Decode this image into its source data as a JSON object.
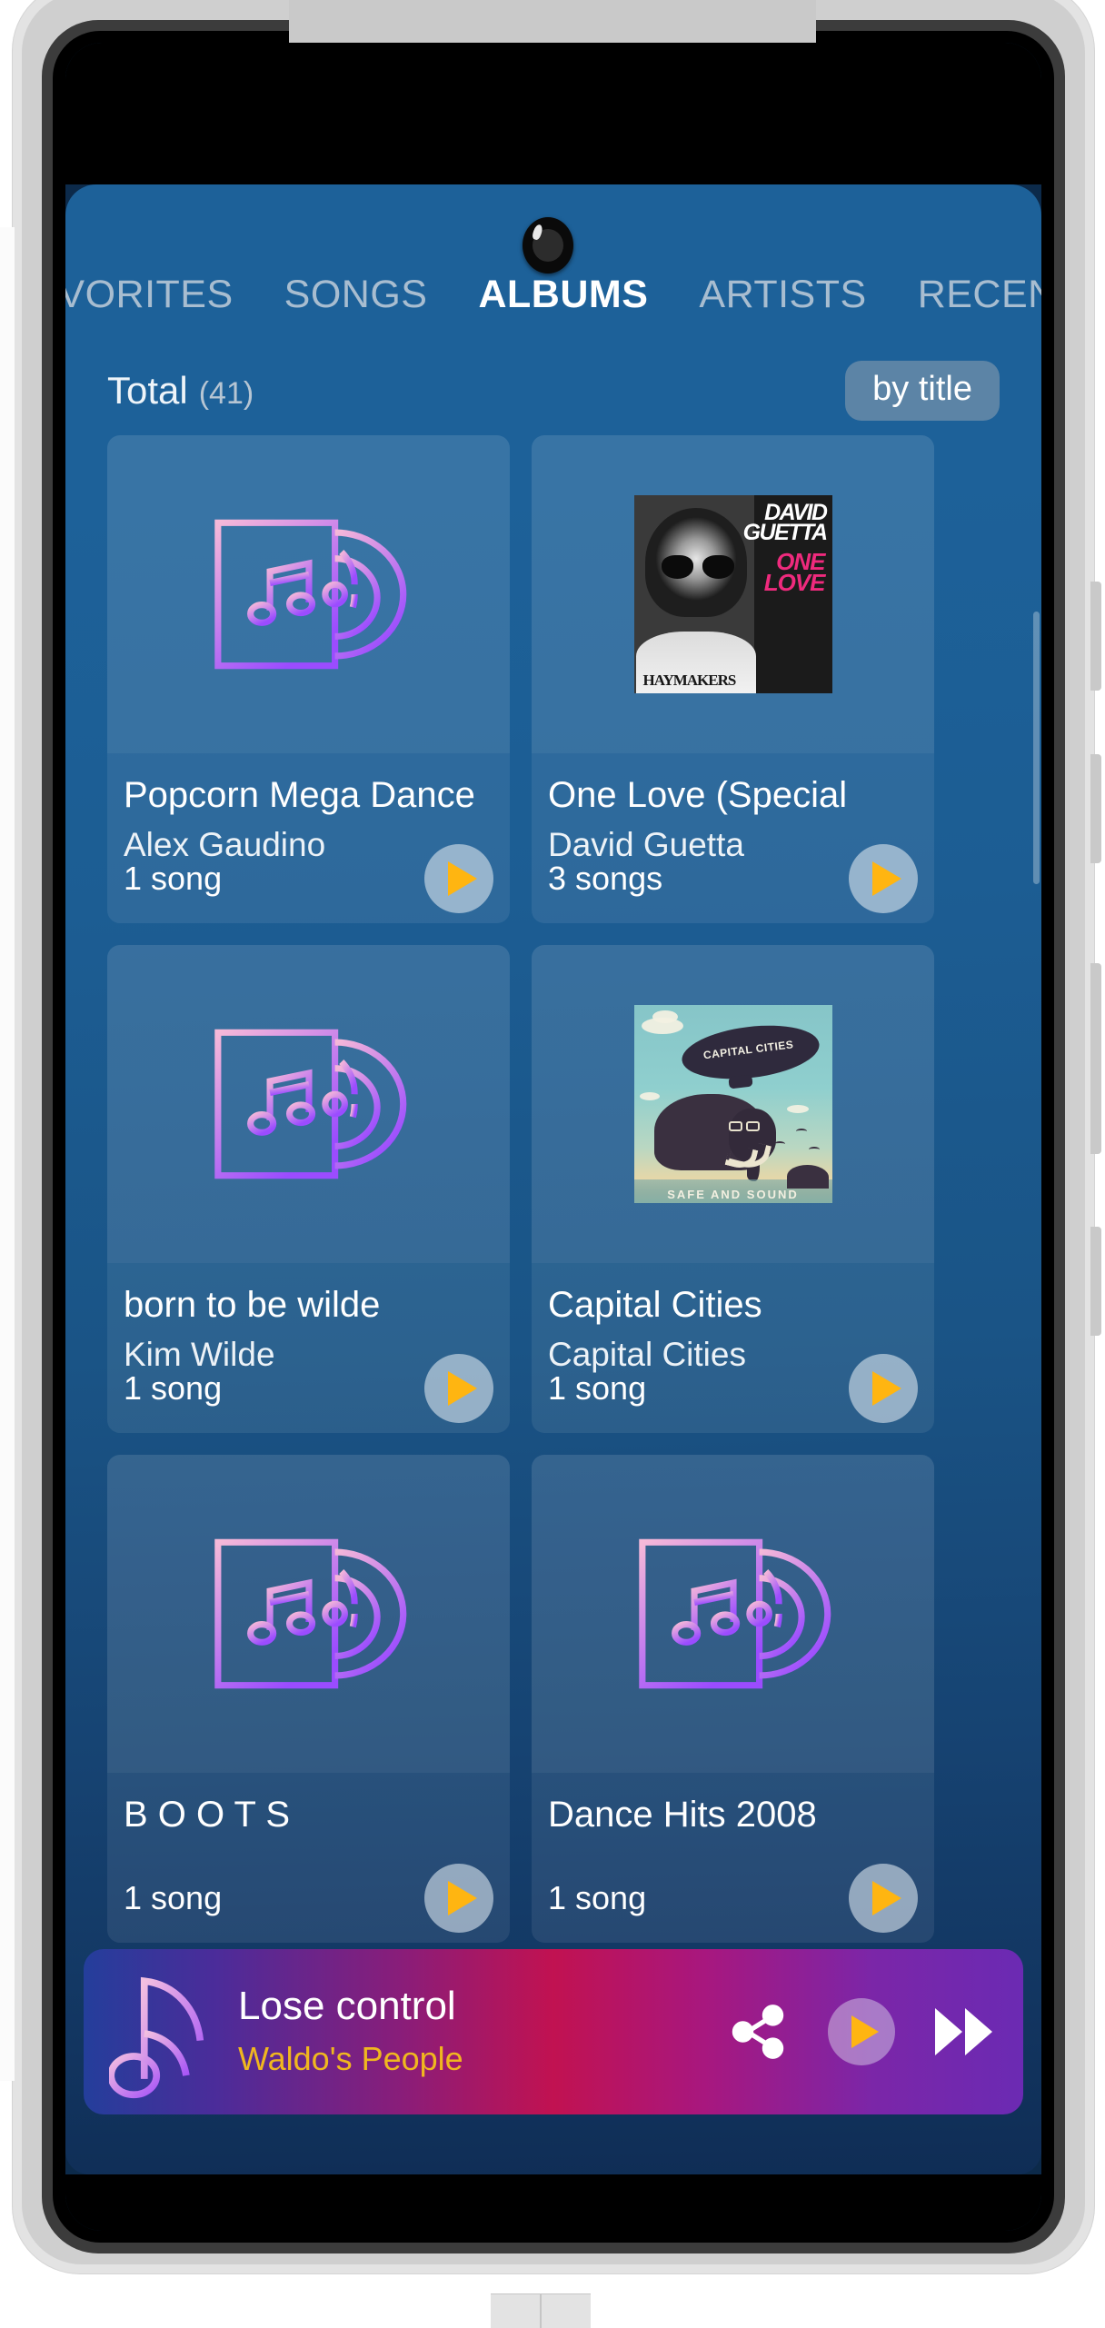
{
  "device": {
    "camera_icon": "front-camera-punch-hole"
  },
  "tabs": [
    {
      "label": "FAVORITES",
      "active": false,
      "truncated_left": true
    },
    {
      "label": "SONGS",
      "active": false
    },
    {
      "label": "ALBUMS",
      "active": true
    },
    {
      "label": "ARTISTS",
      "active": false
    },
    {
      "label": "RECENT",
      "active": false,
      "truncated_right": true
    }
  ],
  "header": {
    "total_label": "Total",
    "total_count": "(41)",
    "sort_button": "by title"
  },
  "albums": [
    {
      "song_count": "1 song",
      "title": "Popcorn Mega Dance",
      "artist": "Alex Gaudino",
      "art": "placeholder",
      "play_icon": "play-icon"
    },
    {
      "song_count": "3 songs",
      "title": "One Love (Special",
      "artist": "David Guetta",
      "art": "guetta",
      "play_icon": "play-icon"
    },
    {
      "song_count": "1 song",
      "title": "born to be wilde",
      "artist": "Kim Wilde",
      "art": "placeholder",
      "play_icon": "play-icon"
    },
    {
      "song_count": "1 song",
      "title": "Capital Cities",
      "artist": "Capital Cities",
      "art": "capitalcities",
      "play_icon": "play-icon"
    },
    {
      "song_count": "1 song",
      "title": "B O O T S",
      "artist": "",
      "art": "placeholder",
      "play_icon": "play-icon"
    },
    {
      "song_count": "1 song",
      "title": "Dance Hits 2008",
      "artist": "",
      "art": "placeholder",
      "play_icon": "play-icon"
    }
  ],
  "album_art_text": {
    "guetta_name_line1": "DAVID",
    "guetta_name_line2": "GUETTA",
    "guetta_one": "ONE",
    "guetta_love": "LOVE",
    "guetta_shirt": "HAYMAKERS",
    "capital_blimp": "CAPITAL CITIES",
    "capital_caption": "SAFE AND SOUND"
  },
  "now_playing": {
    "title": "Lose control",
    "artist": "Waldo's People",
    "note_icon": "music-note-icon",
    "share_icon": "share-icon",
    "play_icon": "play-icon",
    "forward_icon": "fast-forward-icon"
  },
  "colors": {
    "accent_yellow": "#ffb511",
    "bg_blue": "#1d6199",
    "tab_inactive": "#a8bdd0",
    "artist_gold": "#f0b71f"
  }
}
